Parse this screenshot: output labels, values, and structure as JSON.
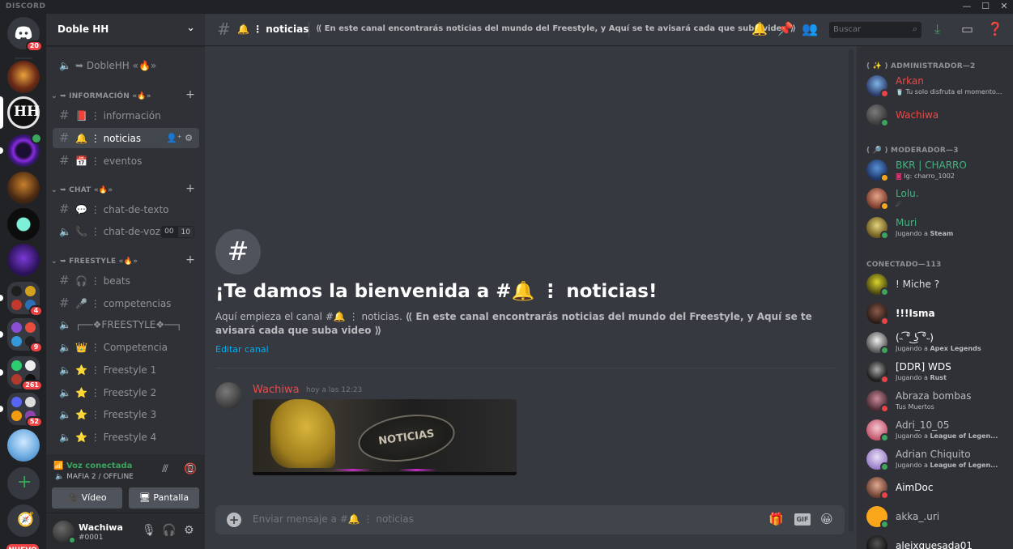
{
  "titlebar": {
    "brand": "DISCORD",
    "min": "—",
    "max": "☐",
    "close": "✕"
  },
  "guild_rail": {
    "home_badge": "20",
    "badges": [
      "4",
      "9",
      "261",
      "52"
    ],
    "new_label": "NUEVO"
  },
  "server": {
    "name": "Doble HH"
  },
  "sidebar": {
    "top_voice": "➥ DobleHH «🔥»",
    "categories": [
      {
        "label": "➥ INFORMACIÓN «🔥»"
      },
      {
        "label": "➥ CHAT «🔥»"
      },
      {
        "label": "➥ FREESTYLE «🔥»"
      }
    ],
    "channels": [
      {
        "label": "📕 ⋮ información"
      },
      {
        "label": "🔔 ⋮ noticias"
      },
      {
        "label": "📅 ⋮ eventos"
      },
      {
        "label": "💬 ⋮ chat-de-texto"
      },
      {
        "label": "📞 ⋮ chat-de-voz"
      },
      {
        "label": "🎧 ⋮ beats"
      },
      {
        "label": "🎤 ⋮ competencias"
      },
      {
        "label": "┌──❖FREESTYLE❖──┐"
      },
      {
        "label": "👑 ⋮ Competencia"
      },
      {
        "label": "⭐ ⋮ Freestyle 1"
      },
      {
        "label": "⭐ ⋮ Freestyle 2"
      },
      {
        "label": "⭐ ⋮ Freestyle 3"
      },
      {
        "label": "⭐ ⋮ Freestyle 4"
      }
    ],
    "voice_counts": [
      "00",
      "10"
    ]
  },
  "voice_panel": {
    "status": "Voz conectada",
    "channel": "MAFIA 2 / OFFLINE",
    "video_label": "Vídeo",
    "screen_label": "Pantalla"
  },
  "user": {
    "name": "Wachiwa",
    "tag": "#0001"
  },
  "topbar": {
    "channel": "🔔 ⋮ noticias",
    "topic": "⟪ En este canal encontrarás noticias del mundo del Freestyle, y Aquí se te avisará cada que suba video ⟫",
    "search_placeholder": "Buscar"
  },
  "welcome": {
    "icon": "#",
    "title": "¡Te damos la bienvenida a #🔔 ⋮ noticias!",
    "desc_prefix": "Aquí empieza el canal #🔔 ⋮ noticias. ",
    "desc_topic": "⟪ En este canal encontrarás noticias del mundo del Freestyle, y Aquí se te avisará cada que suba video ⟫",
    "edit": "Editar canal"
  },
  "message": {
    "author": "Wachiwa",
    "time": "hoy a las 12:23",
    "image_text": "NOTICIAS"
  },
  "composer": {
    "placeholder": "Enviar mensaje a #🔔 ⋮ noticias",
    "gif": "GIF"
  },
  "members": {
    "groups": [
      {
        "label": "( ✨ ) ADMINISTRADOR—2"
      },
      {
        "label": "( 🔎 ) MODERADOR—3"
      },
      {
        "label": "CONECTADO—113"
      }
    ],
    "list": [
      {
        "name": "Arkan",
        "activity": "🥤 Tu solo disfruta el momento..."
      },
      {
        "name": "Wachiwa",
        "activity": ""
      },
      {
        "name": "BKR | CHARRO",
        "activity": "Ig: charro_1002"
      },
      {
        "name": "Lolu.",
        "activity": "☄"
      },
      {
        "name": "Muri",
        "activity_prefix": "Jugando a ",
        "activity_game": "Steam"
      },
      {
        "name": "! Miche ?",
        "activity": ""
      },
      {
        "name": "!!!Isma",
        "activity": ""
      },
      {
        "name": "(˵ ͡° ͜ʖ ͡°˵)",
        "activity_prefix": "Jugando a ",
        "activity_game": "Apex Legends"
      },
      {
        "name": "[DDR] WDS",
        "activity_prefix": "Jugando a ",
        "activity_game": "Rust"
      },
      {
        "name": "Abraza bombas",
        "activity": "Tus Muertos"
      },
      {
        "name": "Adri_10_05",
        "activity_prefix": "Jugando a ",
        "activity_game": "League of Legen..."
      },
      {
        "name": "Adrian Chiquito",
        "activity_prefix": "Jugando a ",
        "activity_game": "League of Legen..."
      },
      {
        "name": "AimDoc",
        "activity": ""
      },
      {
        "name": "akka_.uri",
        "activity": ""
      },
      {
        "name": "aleixquesada01",
        "activity": ""
      }
    ]
  },
  "colors": {
    "admin_role": "#f04747",
    "mod_role": "#43b581",
    "online": "#3ba55d",
    "dnd": "#ed4245",
    "idle": "#faa61a",
    "link": "#00aff4"
  }
}
